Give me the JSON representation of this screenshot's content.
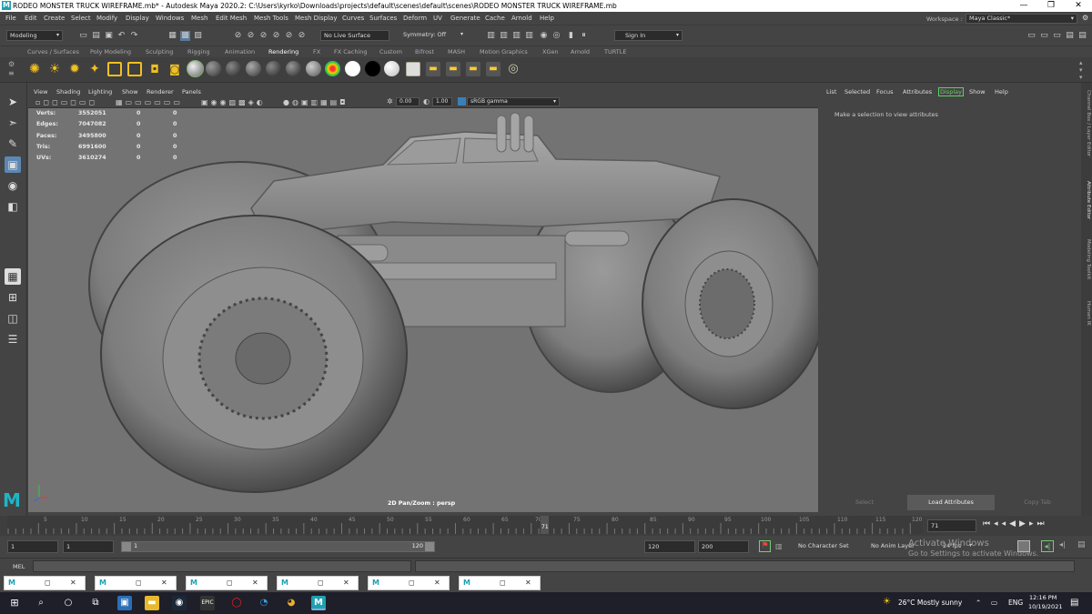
{
  "window": {
    "title": "RODEO MONSTER TRUCK WIREFRAME.mb* - Autodesk Maya 2020.2: C:\\Users\\kyrko\\Downloads\\projects\\default\\scenes\\default\\scenes\\RODEO MONSTER TRUCK WIREFRAME.mb",
    "logo": "M",
    "minimize": "—",
    "maximize": "❐",
    "close": "✕"
  },
  "menu": [
    "File",
    "Edit",
    "Create",
    "Select",
    "Modify",
    "Display",
    "Windows",
    "Mesh",
    "Edit Mesh",
    "Mesh Tools",
    "Mesh Display",
    "Curves",
    "Surfaces",
    "Deform",
    "UV",
    "Generate",
    "Cache",
    "Arnold",
    "Help"
  ],
  "workspace": {
    "label": "Workspace :",
    "value": "Maya Classic*"
  },
  "status": {
    "mode": "Modeling",
    "live_surface": "No Live Surface",
    "symmetry": "Symmetry: Off",
    "sign_in": "Sign In"
  },
  "shelf_tabs": [
    "Curves / Surfaces",
    "Poly Modeling",
    "Sculpting",
    "Rigging",
    "Animation",
    "Rendering",
    "FX",
    "FX Caching",
    "Custom",
    "Bifrost",
    "MASH",
    "Motion Graphics",
    "XGen",
    "Arnold",
    "TURTLE"
  ],
  "active_shelf": "Rendering",
  "viewport": {
    "menu": [
      "View",
      "Shading",
      "Lighting",
      "Show",
      "Renderer",
      "Panels"
    ],
    "exposure": "0.00",
    "gamma": "1.00",
    "colorspace": "sRGB gamma",
    "hud": [
      {
        "label": "Verts:",
        "v1": "3552051",
        "v2": "0",
        "v3": "0"
      },
      {
        "label": "Edges:",
        "v1": "7047082",
        "v2": "0",
        "v3": "0"
      },
      {
        "label": "Faces:",
        "v1": "3495800",
        "v2": "0",
        "v3": "0"
      },
      {
        "label": "Tris:",
        "v1": "6991600",
        "v2": "0",
        "v3": "0"
      },
      {
        "label": "UVs:",
        "v1": "3610274",
        "v2": "0",
        "v3": "0"
      }
    ],
    "caption": "2D Pan/Zoom : persp",
    "maya_logo": "M"
  },
  "attribute_editor": {
    "menu": [
      "List",
      "Selected",
      "Focus",
      "Attributes",
      "Display",
      "Show",
      "Help"
    ],
    "hint": "Make a selection to view attributes",
    "buttons": [
      "Select",
      "Load Attributes",
      "Copy Tab"
    ]
  },
  "side_tabs": [
    "Channel Box / Layer Editor",
    "Attribute Editor",
    "Modeling Toolkit",
    "Human IK"
  ],
  "timeline": {
    "ticks": [
      "5",
      "10",
      "15",
      "20",
      "25",
      "30",
      "35",
      "40",
      "45",
      "50",
      "55",
      "60",
      "65",
      "70",
      "75",
      "80",
      "85",
      "90",
      "95",
      "100",
      "105",
      "110",
      "115",
      "120"
    ],
    "current_frame": "71",
    "current_field": "71"
  },
  "range": {
    "start": "1",
    "playback_start": "1",
    "slider_start": "1",
    "slider_end": "120",
    "playback_end": "120",
    "end": "200",
    "character_set": "No Character Set",
    "anim_layer": "No Anim Layer",
    "fps": "24 fps"
  },
  "mel": {
    "label": "MEL"
  },
  "watermark": {
    "line1": "Activate Windows",
    "line2": "Go to Settings to activate Windows."
  },
  "taskbar": {
    "weather": "26°C  Mostly sunny",
    "lang": "ENG",
    "time": "12:16 PM",
    "date": "10/19/2021"
  }
}
